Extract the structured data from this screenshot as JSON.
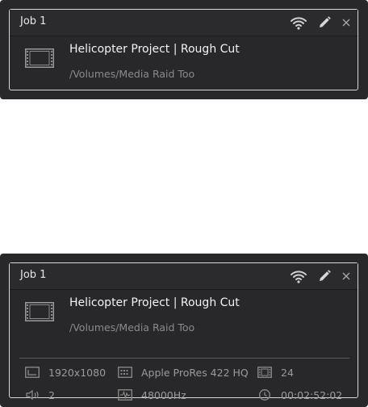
{
  "compact_job": {
    "title": "Job 1",
    "name": "Helicopter Project | Rough Cut",
    "path": "/Volumes/Media Raid Too",
    "icons": [
      "wifi-remote-icon",
      "pencil-edit-icon",
      "close-icon",
      "film-clip-icon"
    ]
  },
  "expanded_job": {
    "title": "Job 1",
    "name": "Helicopter Project | Rough Cut",
    "path": "/Volumes/Media Raid Too",
    "resolution": "1920x1080",
    "codec": "Apple ProRes 422 HQ",
    "frame_rate": "24",
    "audio_channels": "2",
    "sample_rate": "48000Hz",
    "duration": "00:02:52:02",
    "icons": [
      "wifi-remote-icon",
      "pencil-edit-icon",
      "close-icon",
      "film-clip-icon",
      "resolution-icon",
      "codec-icon",
      "frame-rate-icon",
      "audio-channels-icon",
      "sample-rate-icon",
      "duration-clock-icon"
    ]
  },
  "colors": {
    "panel_bg": "#28282a",
    "card_border": "#d8d8d8",
    "text_primary": "#f2f2f2",
    "text_secondary": "#8a8a8a"
  }
}
